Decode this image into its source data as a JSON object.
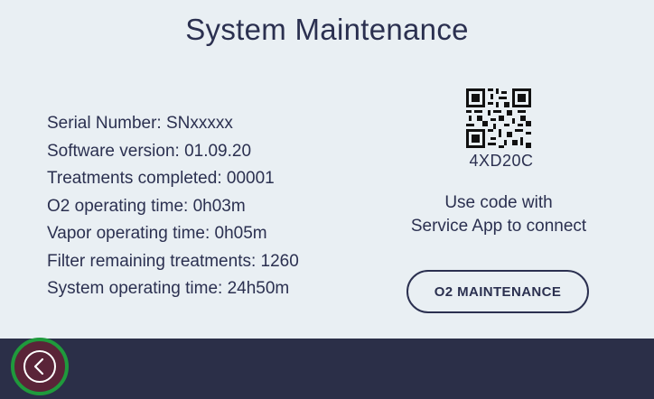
{
  "header": {
    "title": "System Maintenance"
  },
  "info": {
    "serial": "Serial Number: SNxxxxx",
    "software": "Software version: 01.09.20",
    "treatments": "Treatments completed: 00001",
    "o2_time": "O2 operating time: 0h03m",
    "vapor_time": "Vapor operating time: 0h05m",
    "filter": "Filter remaining treatments: 1260",
    "system_time": "System operating time: 24h50m"
  },
  "service": {
    "code": "4XD20C",
    "instruction_line1": "Use code with",
    "instruction_line2": "Service App to connect",
    "button_label": "O2 MAINTENANCE"
  },
  "nav": {
    "back_icon": "chevron-left-circle"
  },
  "colors": {
    "background": "#e9eff3",
    "bar": "#2b2f48",
    "back_highlight": "#1f9a3c"
  }
}
